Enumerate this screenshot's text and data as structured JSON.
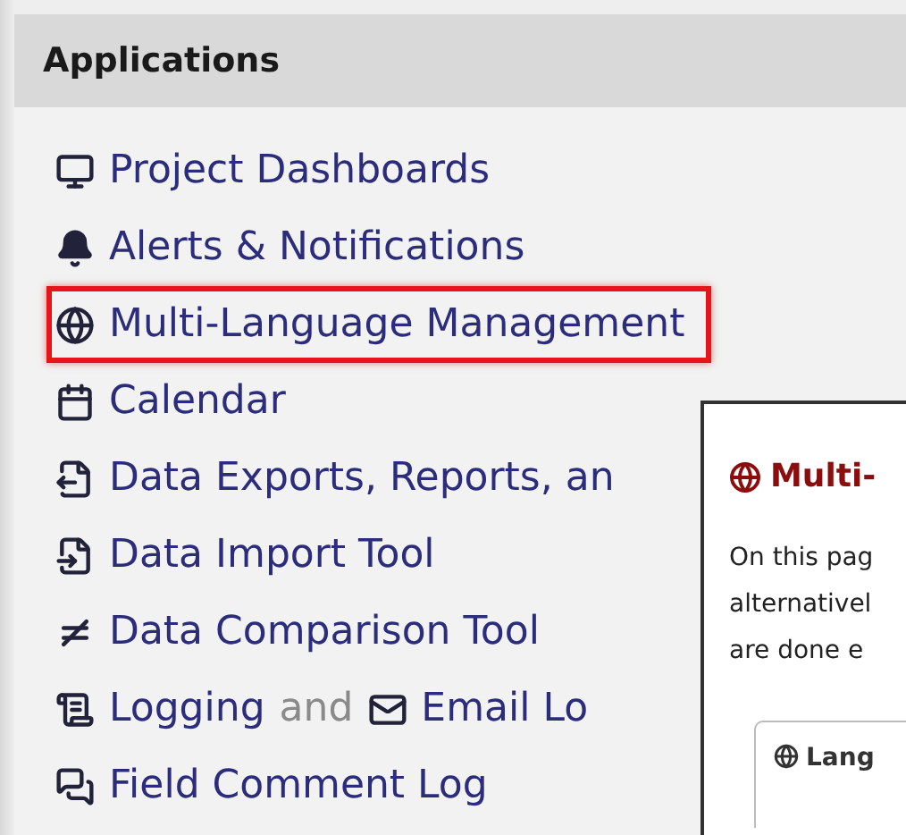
{
  "panel": {
    "title": "Applications"
  },
  "items": [
    {
      "kind": "link",
      "label": "Project Dashboards",
      "highlighted": false
    },
    {
      "kind": "link",
      "label": "Alerts & Notifications",
      "highlighted": false
    },
    {
      "kind": "link",
      "label": "Multi-Language Management",
      "highlighted": true
    },
    {
      "kind": "link",
      "label": "Calendar",
      "highlighted": false
    },
    {
      "kind": "link",
      "label": "Data Exports, Reports, an",
      "highlighted": false
    },
    {
      "kind": "link",
      "label": "Data Import Tool",
      "highlighted": false
    },
    {
      "kind": "link",
      "label": "Data Comparison Tool",
      "highlighted": false
    },
    {
      "kind": "pair",
      "label": "Logging",
      "connector": "and",
      "label2": "Email Lo",
      "highlighted": false
    },
    {
      "kind": "link",
      "label": "Field Comment Log",
      "highlighted": false
    }
  ],
  "popup": {
    "title": "Multi-",
    "lines": [
      "On this pag",
      "alternativel",
      "are done e"
    ],
    "tab": "Lang"
  }
}
